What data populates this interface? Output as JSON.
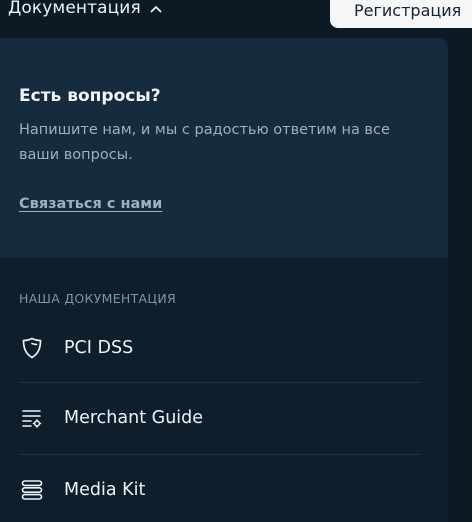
{
  "header": {
    "nav_label": "Документация",
    "register_label": "Регистрация"
  },
  "questions": {
    "title": "Есть вопросы?",
    "text": "Напишите нам, и мы с радостью ответим на все ваши вопросы.",
    "link": "Связаться с нами"
  },
  "docs": {
    "heading": "НАША ДОКУМЕНТАЦИЯ",
    "items": [
      {
        "label": "PCI DSS",
        "icon": "shield-icon"
      },
      {
        "label": "Merchant Guide",
        "icon": "list-settings-icon"
      },
      {
        "label": "Media Kit",
        "icon": "stack-icon"
      }
    ]
  },
  "colors": {
    "page_bg": "#0c1a26",
    "panel_bg": "#0e1e2b",
    "card_bg": "#162b3d",
    "muted_text": "#9fb0c0",
    "button_bg": "#f4f6f8"
  }
}
